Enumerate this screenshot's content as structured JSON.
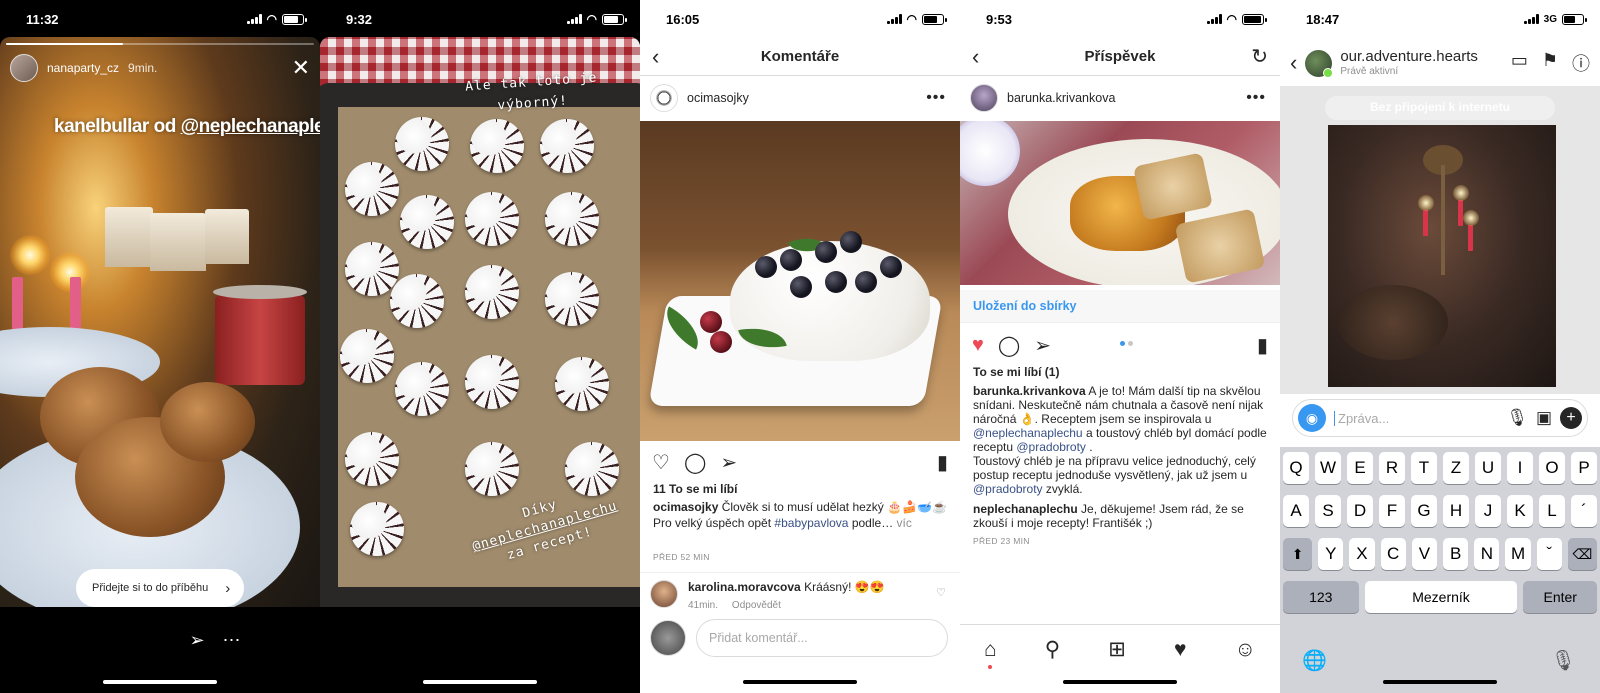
{
  "phones": [
    {
      "status": {
        "time": "11:32"
      },
      "story": {
        "username": "nanaparty_cz",
        "time": "9min.",
        "caption_prefix": "kanelbullar od ",
        "caption_mention": "@neplechanaplechu",
        "cta": "Přidejte si to do příběhu"
      }
    },
    {
      "status": {
        "time": "9:32"
      },
      "story": {
        "handwriting_top": [
          "Ale tak toto je",
          "výborný!"
        ],
        "handwriting_bottom": [
          "Díky",
          "@neplechanaplechu",
          "za recept!"
        ]
      }
    },
    {
      "status": {
        "time": "16:05"
      },
      "title": "Komentáře",
      "post_user": "ocimasojky",
      "likes": "11 To se mi líbí",
      "caption_user": "ocimasojky",
      "caption_text": "Člověk si to musí udělat hezký 🎂🍰🥣☕",
      "caption_line2": "Pro velký úspěch opět",
      "caption_hashtag": "#babypavlova",
      "caption_rest": "podle…",
      "caption_more": "víc",
      "caption_time": "PŘED 52 MIN",
      "comment_user": "karolina.moravcova",
      "comment_text": "Kráásný! 😍😍",
      "comment_time": "41min.",
      "comment_reply": "Odpovědět",
      "add_comment_placeholder": "Přidat komentář..."
    },
    {
      "status": {
        "time": "9:53"
      },
      "title": "Příspěvek",
      "post_user": "barunka.krivankova",
      "save_collection": "Uložení do sbírky",
      "likes": "To se mi líbí (1)",
      "caption_user": "barunka.krivankova",
      "caption_a": "A je to! Mám další tip na skvělou snídani. Neskutečně nám chutnala a časově není nijak náročná 👌. Receptem jsem se inspirovala u",
      "mention_1": "@neplechanaplechu",
      "caption_b": "a toustový chléb byl domácí podle receptu",
      "mention_2": "@pradobroty",
      "caption_c": ".",
      "caption_d": "Toustový chléb je na přípravu velice jednoduchý, celý postup receptu jednoduše vysvětlený, jak už jsem u",
      "mention_3": "@pradobroty",
      "caption_e": "zvyklá.",
      "reply_user": "neplechanaplechu",
      "reply_text": "Je, děkujeme! Jsem rád, že se zkouší i moje recepty! Františék ;)",
      "reply_time": "PŘED 23 MIN"
    },
    {
      "status": {
        "time": "18:47",
        "network": "3G"
      },
      "chat_name": "our.adventure.hearts",
      "chat_status": "Právě aktivní",
      "offline_banner": "Bez připojení k internetu",
      "composer_placeholder": "Zpráva...",
      "keyboard": {
        "row1": [
          "Q",
          "W",
          "E",
          "R",
          "T",
          "Z",
          "U",
          "I",
          "O",
          "P"
        ],
        "row2": [
          "A",
          "S",
          "D",
          "F",
          "G",
          "H",
          "J",
          "K",
          "L",
          "´"
        ],
        "row3": [
          "Y",
          "X",
          "C",
          "V",
          "B",
          "N",
          "M",
          "ˇ"
        ],
        "key_123": "123",
        "key_space": "Mezerník",
        "key_enter": "Enter"
      }
    }
  ],
  "colors": {
    "link_blue": "#385185",
    "action_blue": "#3897f0",
    "like_red": "#ed4956"
  }
}
